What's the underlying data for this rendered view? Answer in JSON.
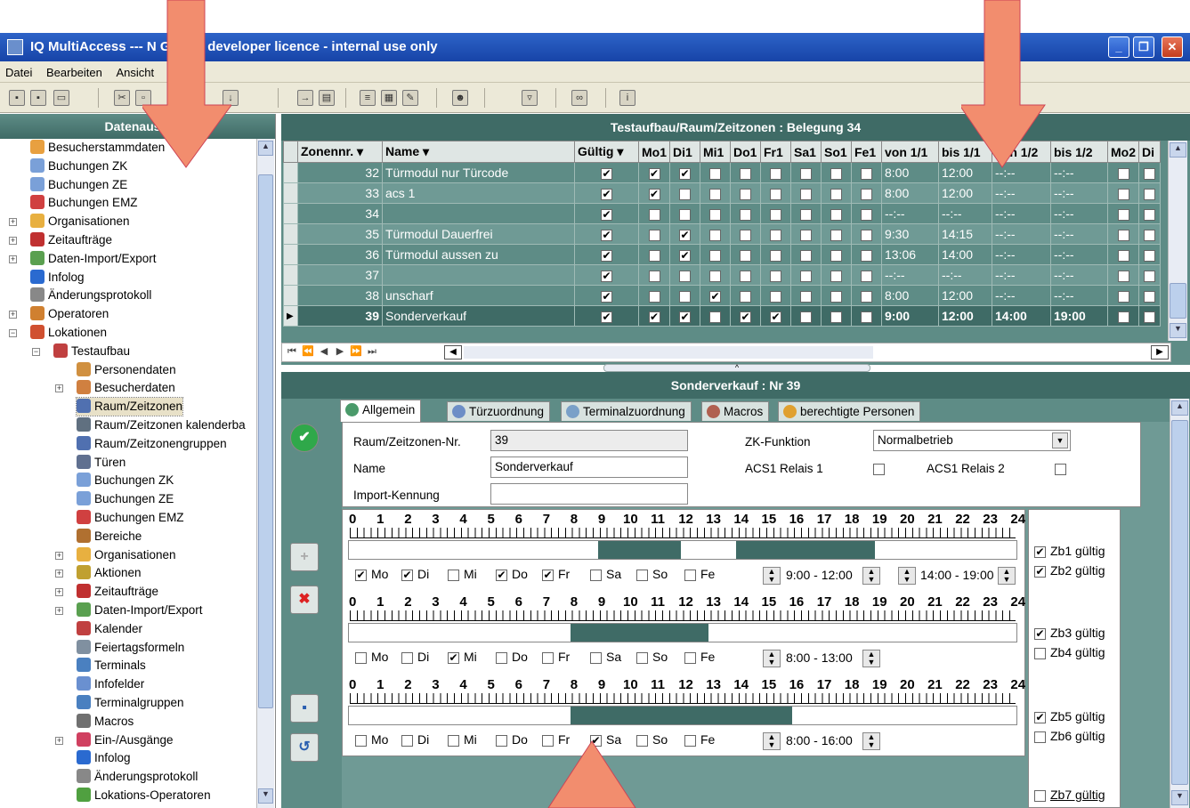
{
  "window": {
    "title": "IQ MultiAccess --- N    GmbH, developer licence - internal use only",
    "controls": {
      "minimize": "_",
      "maximize": "❐",
      "close": "✕"
    }
  },
  "menu": {
    "items": [
      "Datei",
      "Bearbeiten",
      "Ansicht"
    ]
  },
  "left_panel": {
    "title": "Datenausw",
    "items": [
      {
        "label": "Besucherstammdaten",
        "icon": "visitor-icon"
      },
      {
        "label": "Buchungen ZK",
        "icon": "document-icon"
      },
      {
        "label": "Buchungen ZE",
        "icon": "document-icon"
      },
      {
        "label": "Buchungen EMZ",
        "icon": "document-icon"
      },
      {
        "label": "Organisationen",
        "icon": "folder-icon"
      },
      {
        "label": "Zeitaufträge",
        "icon": "calendar-icon"
      },
      {
        "label": "Daten-Import/Export",
        "icon": "globe-icon"
      },
      {
        "label": "Infolog",
        "icon": "info-icon"
      },
      {
        "label": "Änderungsprotokoll",
        "icon": "log-icon"
      },
      {
        "label": "Operatoren",
        "icon": "users-icon"
      },
      {
        "label": "Lokationen",
        "icon": "location-icon"
      },
      {
        "label": "Testaufbau",
        "icon": "building-icon"
      },
      {
        "label": "Personendaten",
        "icon": "person-icon"
      },
      {
        "label": "Besucherdaten",
        "icon": "visitor-icon"
      },
      {
        "label": "Raum/Zeitzonen",
        "icon": "clock-icon"
      },
      {
        "label": "Raum/Zeitzonen kalenderba",
        "icon": "clock-icon"
      },
      {
        "label": "Raum/Zeitzonengruppen",
        "icon": "clock-icon"
      },
      {
        "label": "Türen",
        "icon": "door-icon"
      },
      {
        "label": "Buchungen ZK",
        "icon": "document-icon"
      },
      {
        "label": "Buchungen ZE",
        "icon": "document-icon"
      },
      {
        "label": "Buchungen EMZ",
        "icon": "document-icon"
      },
      {
        "label": "Bereiche",
        "icon": "area-icon"
      },
      {
        "label": "Organisationen",
        "icon": "folder-icon"
      },
      {
        "label": "Aktionen",
        "icon": "action-icon"
      },
      {
        "label": "Zeitaufträge",
        "icon": "calendar-icon"
      },
      {
        "label": "Daten-Import/Export",
        "icon": "globe-icon"
      },
      {
        "label": "Kalender",
        "icon": "calendar-icon"
      },
      {
        "label": "Feiertagsformeln",
        "icon": "formula-icon"
      },
      {
        "label": "Terminals",
        "icon": "terminal-icon"
      },
      {
        "label": "Infofelder",
        "icon": "infofield-icon"
      },
      {
        "label": "Terminalgruppen",
        "icon": "terminal-icon"
      },
      {
        "label": "Macros",
        "icon": "tools-icon"
      },
      {
        "label": "Ein-/Ausgänge",
        "icon": "io-icon"
      },
      {
        "label": "Infolog",
        "icon": "info-icon"
      },
      {
        "label": "Änderungsprotokoll",
        "icon": "log-icon"
      },
      {
        "label": "Lokations-Operatoren",
        "icon": "person-icon"
      }
    ]
  },
  "grid": {
    "title": "Testaufbau/Raum/Zeitzonen : Belegung 34",
    "columns": [
      "Zonennr.",
      "Name",
      "Gültig",
      "Mo1",
      "Di1",
      "Mi1",
      "Do1",
      "Fr1",
      "Sa1",
      "So1",
      "Fe1",
      "von 1/1",
      "bis 1/1",
      "von 1/2",
      "bis 1/2",
      "Mo2",
      "Di"
    ],
    "rows": [
      {
        "nr": "32",
        "name": "Türmodul nur Türcode",
        "checks": [
          1,
          1,
          1,
          0,
          0,
          0,
          0,
          0,
          0
        ],
        "v1": "8:00",
        "b1": "12:00",
        "v2": "--:--",
        "b2": "--:--"
      },
      {
        "nr": "33",
        "name": "acs 1",
        "checks": [
          1,
          1,
          0,
          0,
          0,
          0,
          0,
          0,
          0
        ],
        "v1": "8:00",
        "b1": "12:00",
        "v2": "--:--",
        "b2": "--:--"
      },
      {
        "nr": "34",
        "name": "",
        "checks": [
          1,
          0,
          0,
          0,
          0,
          0,
          0,
          0,
          0
        ],
        "v1": "--:--",
        "b1": "--:--",
        "v2": "--:--",
        "b2": "--:--"
      },
      {
        "nr": "35",
        "name": "Türmodul Dauerfrei",
        "checks": [
          1,
          0,
          1,
          0,
          0,
          0,
          0,
          0,
          0
        ],
        "v1": "9:30",
        "b1": "14:15",
        "v2": "--:--",
        "b2": "--:--"
      },
      {
        "nr": "36",
        "name": "Türmodul aussen zu",
        "checks": [
          1,
          0,
          1,
          0,
          0,
          0,
          0,
          0,
          0
        ],
        "v1": "13:06",
        "b1": "14:00",
        "v2": "--:--",
        "b2": "--:--"
      },
      {
        "nr": "37",
        "name": "",
        "checks": [
          1,
          0,
          0,
          0,
          0,
          0,
          0,
          0,
          0
        ],
        "v1": "--:--",
        "b1": "--:--",
        "v2": "--:--",
        "b2": "--:--"
      },
      {
        "nr": "38",
        "name": "unscharf",
        "checks": [
          1,
          0,
          0,
          1,
          0,
          0,
          0,
          0,
          0
        ],
        "v1": "8:00",
        "b1": "12:00",
        "v2": "--:--",
        "b2": "--:--"
      },
      {
        "nr": "39",
        "name": "Sonderverkauf",
        "checks": [
          1,
          1,
          1,
          0,
          1,
          1,
          0,
          0,
          0
        ],
        "v1": "9:00",
        "b1": "12:00",
        "v2": "14:00",
        "b2": "19:00"
      }
    ],
    "nav": [
      "⏮",
      "⏪",
      "◀",
      "▶",
      "⏩",
      "⏭"
    ]
  },
  "detail": {
    "title": "Sonderverkauf : Nr 39",
    "tabs": [
      "Allgemein",
      "Türzuordnung",
      "Terminalzuordnung",
      "Macros",
      "berechtigte Personen"
    ],
    "fields": {
      "nr_label": "Raum/Zeitzonen-Nr.",
      "nr_value": "39",
      "name_label": "Name",
      "name_value": "Sonderverkauf",
      "import_label": "Import-Kennung",
      "import_value": "",
      "zk_label": "ZK-Funktion",
      "zk_value": "Normalbetrieb",
      "relais1_label": "ACS1 Relais 1",
      "relais2_label": "ACS1 Relais 2"
    },
    "hours": [
      "0",
      "1",
      "2",
      "3",
      "4",
      "5",
      "6",
      "7",
      "8",
      "9",
      "10",
      "11",
      "12",
      "13",
      "14",
      "15",
      "16",
      "17",
      "18",
      "19",
      "20",
      "21",
      "22",
      "23",
      "24"
    ],
    "days": [
      "Mo",
      "Di",
      "Mi",
      "Do",
      "Fr",
      "Sa",
      "So",
      "Fe"
    ],
    "blocks": [
      {
        "checked": [
          1,
          1,
          0,
          1,
          1,
          0,
          0,
          0
        ],
        "segments": [
          [
            9,
            12
          ],
          [
            14,
            19
          ]
        ],
        "time1": "9:00 - 12:00",
        "time2": "14:00 - 19:00",
        "zb": [
          {
            "label": "Zb1 gültig",
            "checked": true
          },
          {
            "label": "Zb2 gültig",
            "checked": true
          }
        ]
      },
      {
        "checked": [
          0,
          0,
          1,
          0,
          0,
          0,
          0,
          0
        ],
        "segments": [
          [
            8,
            13
          ]
        ],
        "time1": "8:00 - 13:00",
        "time2": "",
        "zb": [
          {
            "label": "Zb3 gültig",
            "checked": true
          },
          {
            "label": "Zb4 gültig",
            "checked": false
          }
        ]
      },
      {
        "checked": [
          0,
          0,
          0,
          0,
          0,
          1,
          0,
          0
        ],
        "segments": [
          [
            8,
            16
          ]
        ],
        "time1": "8:00 - 16:00",
        "time2": "",
        "zb": [
          {
            "label": "Zb5 gültig",
            "checked": true
          },
          {
            "label": "Zb6 gültig",
            "checked": false
          }
        ]
      }
    ],
    "zb7": "Zb7 gültig"
  },
  "colors": {
    "accent": "#3f6b66",
    "panel": "#5e8c86",
    "title": "#2d63c8"
  }
}
